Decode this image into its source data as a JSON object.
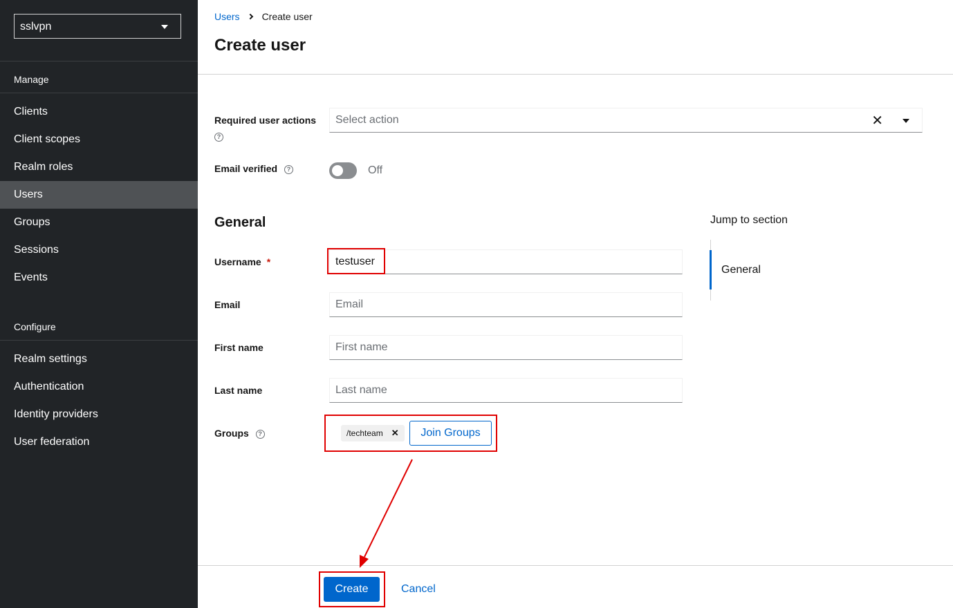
{
  "sidebar": {
    "realm": "sslvpn",
    "manage_title": "Manage",
    "manage_items": [
      "Clients",
      "Client scopes",
      "Realm roles",
      "Users",
      "Groups",
      "Sessions",
      "Events"
    ],
    "active_item": "Users",
    "configure_title": "Configure",
    "configure_items": [
      "Realm settings",
      "Authentication",
      "Identity providers",
      "User federation"
    ]
  },
  "breadcrumb": {
    "parent": "Users",
    "current": "Create user"
  },
  "page_title": "Create user",
  "form": {
    "required_actions_label": "Required user actions",
    "required_actions_placeholder": "Select action",
    "email_verified_label": "Email verified",
    "email_verified_state": "Off",
    "general_heading": "General",
    "username_label": "Username",
    "username_required_mark": "*",
    "username_value": "testuser",
    "email_label": "Email",
    "email_placeholder": "Email",
    "first_name_label": "First name",
    "first_name_placeholder": "First name",
    "last_name_label": "Last name",
    "last_name_placeholder": "Last name",
    "groups_label": "Groups",
    "group_chip": "/techteam",
    "join_groups_label": "Join Groups"
  },
  "jump": {
    "title": "Jump to section",
    "items": [
      "General"
    ]
  },
  "footer": {
    "create_label": "Create",
    "cancel_label": "Cancel"
  },
  "colors": {
    "sidebar_bg": "#212427",
    "active_item_bg": "#4f5255",
    "accent": "#0066cc",
    "annotation": "#e00000"
  },
  "icons": {
    "help": "help-icon",
    "clear": "close-icon",
    "caret": "caret-down-icon",
    "chevron": "chevron-right-icon"
  }
}
